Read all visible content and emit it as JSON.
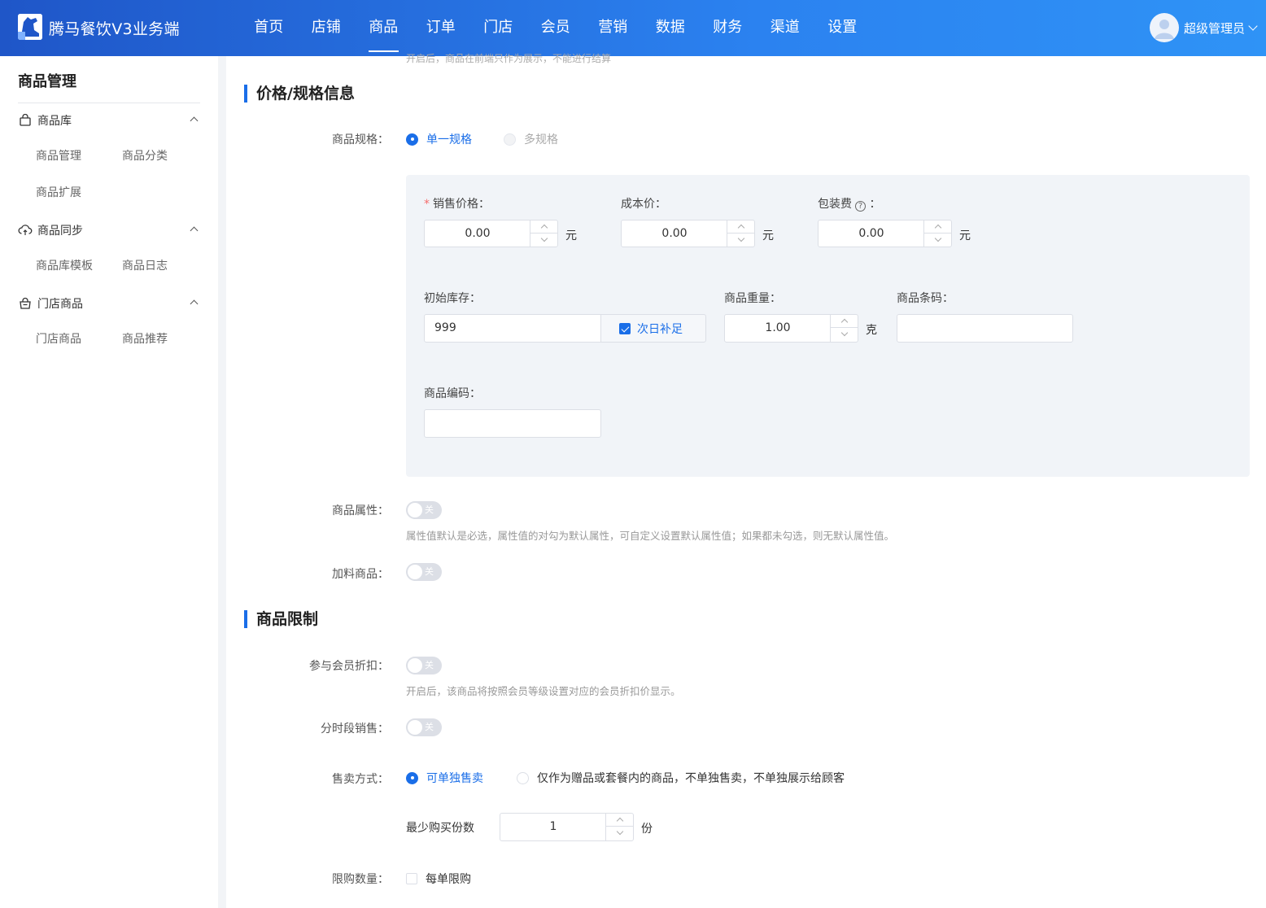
{
  "header": {
    "app_title": "腾马餐饮V3业务端",
    "nav": [
      "首页",
      "店铺",
      "商品",
      "订单",
      "门店",
      "会员",
      "营销",
      "数据",
      "财务",
      "渠道",
      "设置"
    ],
    "active_nav": "商品",
    "user_name": "超级管理员"
  },
  "sidebar": {
    "title": "商品管理",
    "groups": [
      {
        "label": "商品库",
        "icon": "bag-icon",
        "items": [
          "商品管理",
          "商品分类",
          "商品扩展"
        ]
      },
      {
        "label": "商品同步",
        "icon": "cloud-sync-icon",
        "items": [
          "商品库模板",
          "商品日志"
        ]
      },
      {
        "label": "门店商品",
        "icon": "basket-icon",
        "items": [
          "门店商品",
          "商品推荐"
        ]
      }
    ]
  },
  "form": {
    "cut_tip": "开启后，商品在前端只作为展示，不能进行结算",
    "price_section": {
      "title": "价格/规格信息",
      "spec_label": "商品规格：",
      "spec_options": [
        "单一规格",
        "多规格"
      ],
      "spec_selected": "单一规格",
      "sale_price": {
        "label": "销售价格：",
        "value": "0.00",
        "unit": "元"
      },
      "cost_price": {
        "label": "成本价：",
        "value": "0.00",
        "unit": "元"
      },
      "packing_fee": {
        "label": "包装费",
        "label_suffix": "：",
        "value": "0.00",
        "unit": "元"
      },
      "initial_stock": {
        "label": "初始库存：",
        "value": "999",
        "restock_label": "次日补足",
        "restock_checked": true
      },
      "weight": {
        "label": "商品重量：",
        "value": "1.00",
        "unit": "克"
      },
      "barcode": {
        "label": "商品条码：",
        "value": ""
      },
      "code": {
        "label": "商品编码：",
        "value": ""
      },
      "attr": {
        "label": "商品属性：",
        "switch_text": "关",
        "tip": "属性值默认是必选，属性值的对勾为默认属性，可自定义设置默认属性值；如果都未勾选，则无默认属性值。"
      },
      "addon": {
        "label": "加料商品：",
        "switch_text": "关"
      }
    },
    "limit_section": {
      "title": "商品限制",
      "member_discount": {
        "label": "参与会员折扣：",
        "switch_text": "关",
        "tip": "开启后，该商品将按照会员等级设置对应的会员折扣价显示。"
      },
      "timed_sale": {
        "label": "分时段销售：",
        "switch_text": "关"
      },
      "sale_mode": {
        "label": "售卖方式：",
        "options": [
          "可单独售卖",
          "仅作为赠品或套餐内的商品，不单独售卖，不单独展示给顾客"
        ],
        "selected": "可单独售卖"
      },
      "min_purchase": {
        "label": "最少购买份数",
        "value": "1",
        "unit": "份"
      },
      "limit_qty": {
        "label": "限购数量：",
        "option": "每单限购",
        "checked": false
      }
    }
  },
  "colors": {
    "primary": "#1a6ee8",
    "header_start": "#1f56c8",
    "header_end": "#2f93f6"
  }
}
